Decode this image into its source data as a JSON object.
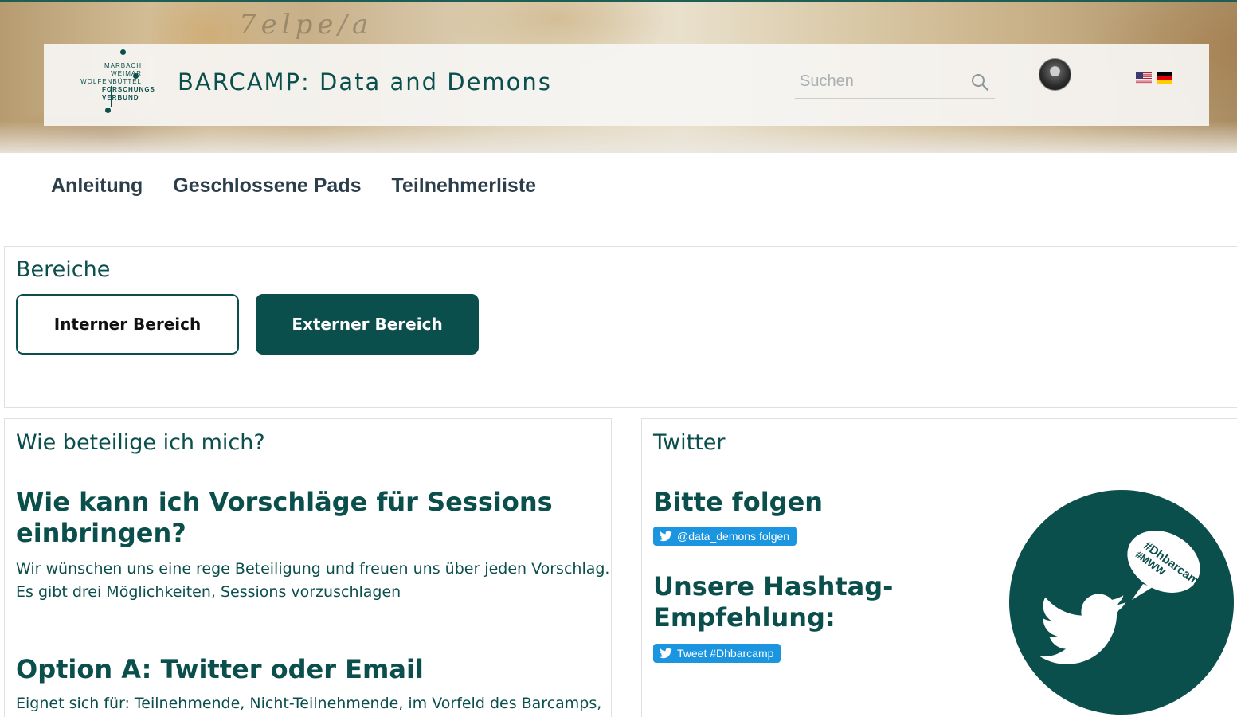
{
  "header": {
    "logo": {
      "lines_left": [
        "MARBACH",
        "WEIMAR",
        "WOLFENBÜTTEL"
      ],
      "lines_right": [
        "FORSCHUNGS",
        "VERBUND"
      ]
    },
    "site_title": "BARCAMP: Data and Demons",
    "search": {
      "placeholder": "Suchen"
    },
    "hero_scribble": "7elpe/a"
  },
  "nav": {
    "items": [
      {
        "label": "Anleitung"
      },
      {
        "label": "Geschlossene Pads"
      },
      {
        "label": "Teilnehmerliste"
      }
    ]
  },
  "areas": {
    "title": "Bereiche",
    "internal_label": "Interner Bereich",
    "external_label": "Externer Bereich"
  },
  "participation": {
    "title": "Wie beteilige ich mich?",
    "question_heading": "Wie kann ich Vorschläge für Sessions einbringen?",
    "intro_line1": "Wir wünschen uns eine rege Beteiligung und freuen uns über jeden Vorschlag.",
    "intro_line2": "Es gibt drei Möglichkeiten, Sessions vorzuschlagen",
    "option_a_heading": "Option A: Twitter oder Email",
    "option_a_text": "Eignet sich für: Teilnehmende, Nicht-Teilnehmende, im Vorfeld des Barcamps,"
  },
  "twitter": {
    "title": "Twitter",
    "follow_heading": "Bitte folgen",
    "follow_button": "@data_demons folgen",
    "hashtag_heading_line1": "Unsere Hashtag-",
    "hashtag_heading_line2": "Empfehlung:",
    "tweet_button": "Tweet #Dhbarcamp",
    "graphic_hashtag1": "#Dhbarcamp",
    "graphic_hashtag2": "#MWW"
  },
  "colors": {
    "brand": "#0b4f4c",
    "nav_text": "#2c3e4a",
    "twitter_blue": "#1b95e0"
  }
}
